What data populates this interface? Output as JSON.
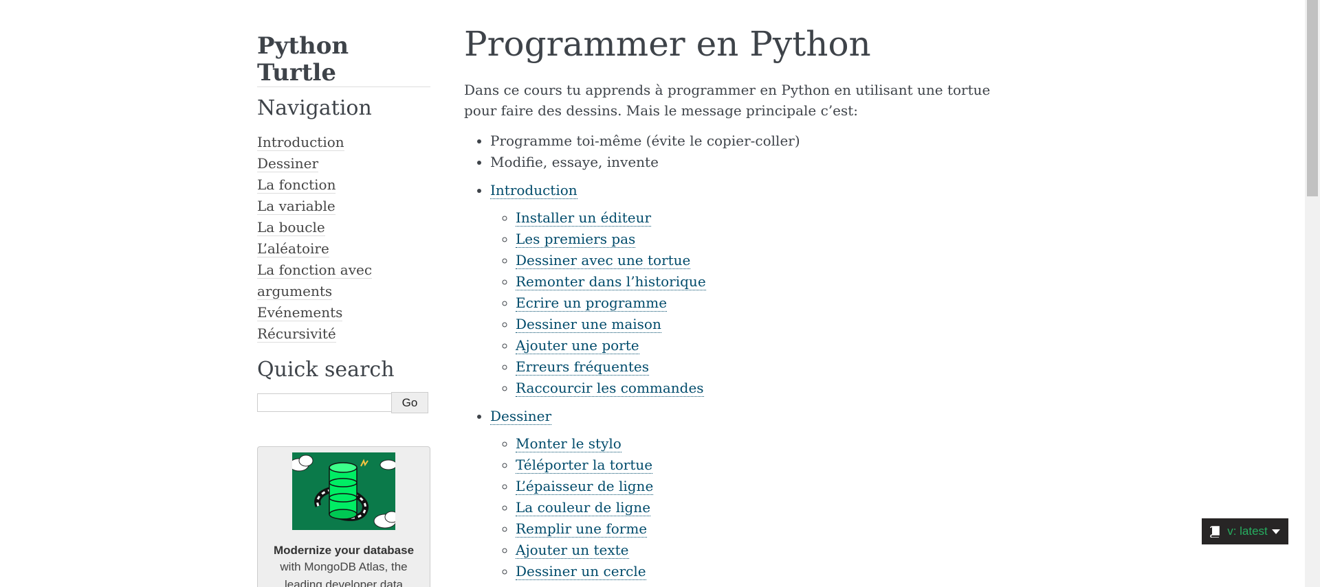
{
  "sidebar": {
    "brand": "Python Turtle",
    "navigation_heading": "Navigation",
    "nav_items": [
      {
        "label": "Introduction"
      },
      {
        "label": "Dessiner"
      },
      {
        "label": "La fonction"
      },
      {
        "label": "La variable"
      },
      {
        "label": "La boucle"
      },
      {
        "label": "L’aléatoire"
      },
      {
        "label": "La fonction avec"
      },
      {
        "label": "arguments"
      },
      {
        "label": "Evénements"
      },
      {
        "label": "Récursivité"
      }
    ],
    "search_heading": "Quick search",
    "search_value": "",
    "search_button": "Go",
    "ad": {
      "title": "Modernize your database",
      "line1": "with MongoDB Atlas, the",
      "line2": "leading developer data"
    }
  },
  "main": {
    "title": "Programmer en Python",
    "intro": "Dans ce cours tu apprends à programmer en Python en utilisant une tortue pour faire des dessins. Mais le message principale c’est:",
    "bullets": [
      "Programme toi-même (évite le copier-coller)",
      "Modifie, essaye, invente"
    ],
    "toc": [
      {
        "label": "Introduction",
        "children": [
          "Installer un éditeur",
          "Les premiers pas",
          "Dessiner avec une tortue",
          "Remonter dans l’historique",
          "Ecrire un programme",
          "Dessiner une maison",
          "Ajouter une porte",
          "Erreurs fréquentes",
          "Raccourcir les commandes"
        ]
      },
      {
        "label": "Dessiner",
        "children": [
          "Monter le stylo",
          "Téléporter la tortue",
          "L’épaisseur de ligne",
          "La couleur de ligne",
          "Remplir une forme",
          "Ajouter un texte",
          "Dessiner un cercle"
        ]
      }
    ]
  },
  "version_badge": {
    "label": "v: latest",
    "color": "#27ae60"
  }
}
